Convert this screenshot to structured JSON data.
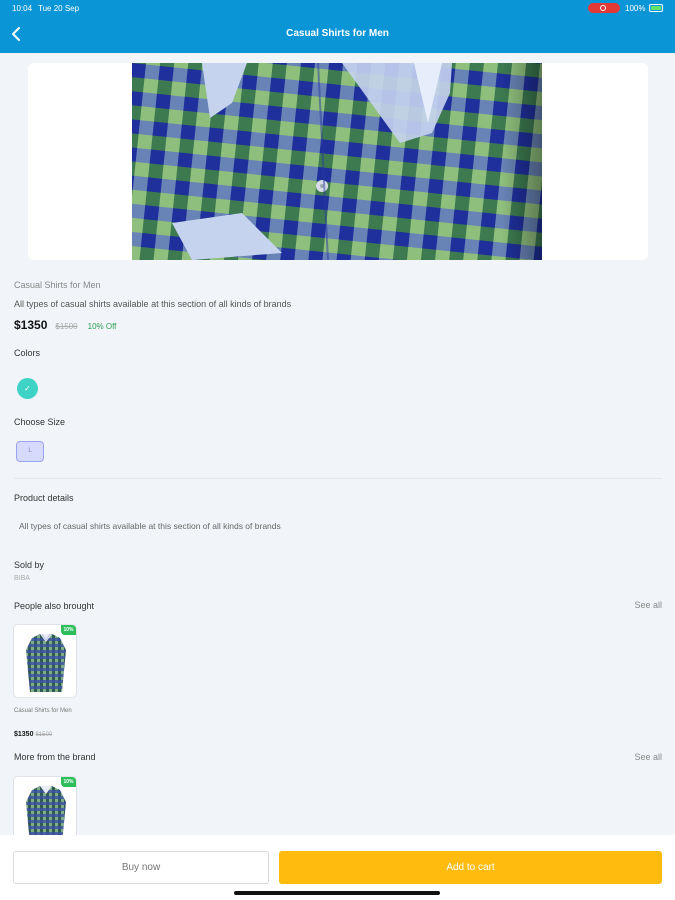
{
  "status_bar": {
    "time": "10:04",
    "date": "Tue 20 Sep",
    "battery": "100%"
  },
  "header": {
    "title": "Casual Shirts for Men",
    "back_icon": "chevron-left-icon"
  },
  "product": {
    "name": "Casual Shirts for Men",
    "description": "All types of casual shirts available at this section of all kinds of brands",
    "price": "$1350",
    "mrp": "$1500",
    "discount": "10% Off"
  },
  "colors": {
    "label": "Colors",
    "selected": "#3fd3c8",
    "check": "✓"
  },
  "sizes": {
    "label": "Choose Size",
    "options": [
      "L"
    ]
  },
  "details": {
    "label": "Product details",
    "text": "All types of casual shirts available at this section of all kinds of brands"
  },
  "seller": {
    "label": "Sold by",
    "name": "BIBA"
  },
  "also_bought": {
    "label": "People also brought",
    "see_all": "See all",
    "items": [
      {
        "badge": "10%",
        "name": "Casual Shirts for Men",
        "price": "$1350",
        "mrp": "$1500"
      }
    ]
  },
  "more_brand": {
    "label": "More from the brand",
    "see_all": "See all",
    "items": [
      {
        "badge": "10%"
      }
    ]
  },
  "actions": {
    "buy_now": "Buy now",
    "add_to_cart": "Add to cart"
  },
  "theme": {
    "primary": "#0a95d7",
    "accent": "#ffbc0f",
    "success": "#2ebf5b",
    "background": "#f1f5f9"
  }
}
